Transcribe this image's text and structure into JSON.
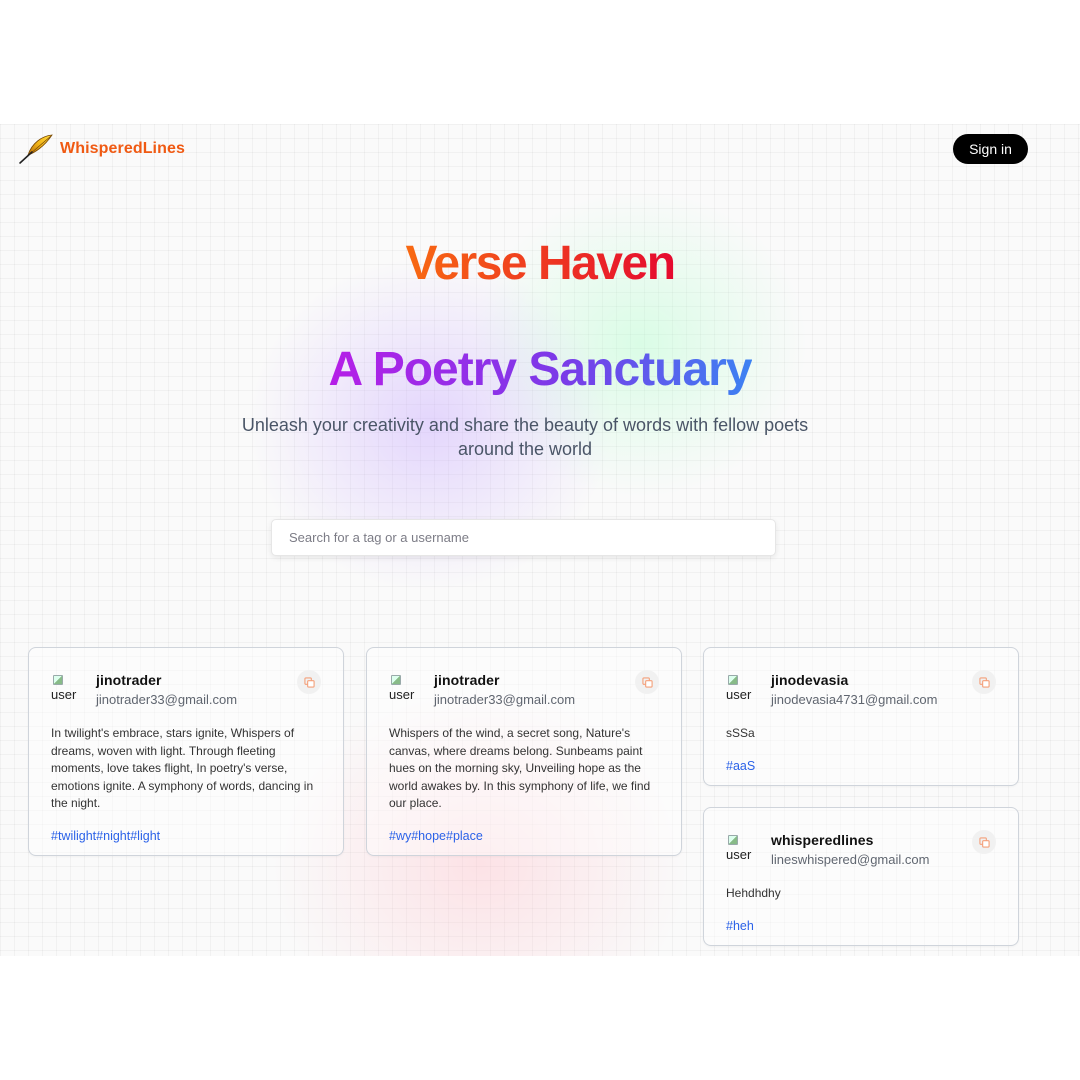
{
  "nav": {
    "brand": "WhisperedLines",
    "signin_label": "Sign in"
  },
  "hero": {
    "title": "Verse Haven",
    "subtitle": "A Poetry Sanctuary",
    "description": "Unleash your creativity and share the beauty of words with fellow poets around the world"
  },
  "search": {
    "placeholder": "Search for a tag or a username",
    "value": ""
  },
  "posts": [
    {
      "avatar_alt": "user",
      "username": "jinotrader",
      "email": "jinotrader33@gmail.com",
      "text": "In twilight's embrace, stars ignite, Whispers of dreams, woven with light. Through fleeting moments, love takes flight, In poetry's verse, emotions ignite. A symphony of words, dancing in the night.",
      "tags": [
        "#twilight",
        "#night",
        "#light"
      ]
    },
    {
      "avatar_alt": "user",
      "username": "jinotrader",
      "email": "jinotrader33@gmail.com",
      "text": "Whispers of the wind, a secret song, Nature's canvas, where dreams belong. Sunbeams paint hues on the morning sky, Unveiling hope as the world awakes by. In this symphony of life, we find our place.",
      "tags": [
        "#wy",
        "#hope",
        "#place"
      ]
    },
    {
      "avatar_alt": "user",
      "username": "jinodevasia",
      "email": "jinodevasia4731@gmail.com",
      "text": "sSSa",
      "tags": [
        "#aaS"
      ]
    },
    {
      "avatar_alt": "user",
      "username": "whisperedlines",
      "email": "lineswhispered@gmail.com",
      "text": "Hehdhdhy",
      "tags": [
        "#heh"
      ]
    }
  ],
  "icons": {
    "logo": "quill-feather-icon",
    "copy": "copy-icon"
  },
  "colors": {
    "brand": "#f05a13",
    "tag": "#2b62e8",
    "title_gradient": [
      "#f86a12",
      "#e5092f"
    ],
    "subtitle_gradient": [
      "#b61fe7",
      "#7b3ae8",
      "#3c82f2"
    ]
  }
}
